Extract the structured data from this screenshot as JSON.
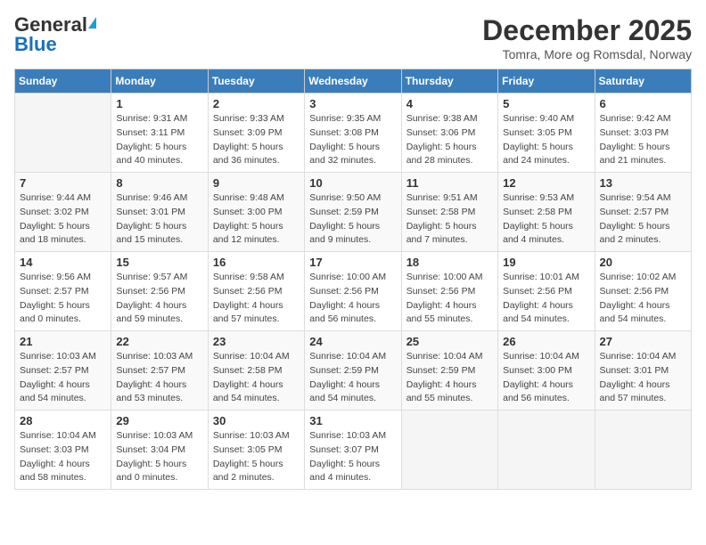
{
  "header": {
    "logo_general": "General",
    "logo_blue": "Blue",
    "month_year": "December 2025",
    "location": "Tomra, More og Romsdal, Norway"
  },
  "days_of_week": [
    "Sunday",
    "Monday",
    "Tuesday",
    "Wednesday",
    "Thursday",
    "Friday",
    "Saturday"
  ],
  "weeks": [
    [
      {
        "day": null,
        "info": null
      },
      {
        "day": "1",
        "info": "Sunrise: 9:31 AM\nSunset: 3:11 PM\nDaylight: 5 hours\nand 40 minutes."
      },
      {
        "day": "2",
        "info": "Sunrise: 9:33 AM\nSunset: 3:09 PM\nDaylight: 5 hours\nand 36 minutes."
      },
      {
        "day": "3",
        "info": "Sunrise: 9:35 AM\nSunset: 3:08 PM\nDaylight: 5 hours\nand 32 minutes."
      },
      {
        "day": "4",
        "info": "Sunrise: 9:38 AM\nSunset: 3:06 PM\nDaylight: 5 hours\nand 28 minutes."
      },
      {
        "day": "5",
        "info": "Sunrise: 9:40 AM\nSunset: 3:05 PM\nDaylight: 5 hours\nand 24 minutes."
      },
      {
        "day": "6",
        "info": "Sunrise: 9:42 AM\nSunset: 3:03 PM\nDaylight: 5 hours\nand 21 minutes."
      }
    ],
    [
      {
        "day": "7",
        "info": "Sunrise: 9:44 AM\nSunset: 3:02 PM\nDaylight: 5 hours\nand 18 minutes."
      },
      {
        "day": "8",
        "info": "Sunrise: 9:46 AM\nSunset: 3:01 PM\nDaylight: 5 hours\nand 15 minutes."
      },
      {
        "day": "9",
        "info": "Sunrise: 9:48 AM\nSunset: 3:00 PM\nDaylight: 5 hours\nand 12 minutes."
      },
      {
        "day": "10",
        "info": "Sunrise: 9:50 AM\nSunset: 2:59 PM\nDaylight: 5 hours\nand 9 minutes."
      },
      {
        "day": "11",
        "info": "Sunrise: 9:51 AM\nSunset: 2:58 PM\nDaylight: 5 hours\nand 7 minutes."
      },
      {
        "day": "12",
        "info": "Sunrise: 9:53 AM\nSunset: 2:58 PM\nDaylight: 5 hours\nand 4 minutes."
      },
      {
        "day": "13",
        "info": "Sunrise: 9:54 AM\nSunset: 2:57 PM\nDaylight: 5 hours\nand 2 minutes."
      }
    ],
    [
      {
        "day": "14",
        "info": "Sunrise: 9:56 AM\nSunset: 2:57 PM\nDaylight: 5 hours\nand 0 minutes."
      },
      {
        "day": "15",
        "info": "Sunrise: 9:57 AM\nSunset: 2:56 PM\nDaylight: 4 hours\nand 59 minutes."
      },
      {
        "day": "16",
        "info": "Sunrise: 9:58 AM\nSunset: 2:56 PM\nDaylight: 4 hours\nand 57 minutes."
      },
      {
        "day": "17",
        "info": "Sunrise: 10:00 AM\nSunset: 2:56 PM\nDaylight: 4 hours\nand 56 minutes."
      },
      {
        "day": "18",
        "info": "Sunrise: 10:00 AM\nSunset: 2:56 PM\nDaylight: 4 hours\nand 55 minutes."
      },
      {
        "day": "19",
        "info": "Sunrise: 10:01 AM\nSunset: 2:56 PM\nDaylight: 4 hours\nand 54 minutes."
      },
      {
        "day": "20",
        "info": "Sunrise: 10:02 AM\nSunset: 2:56 PM\nDaylight: 4 hours\nand 54 minutes."
      }
    ],
    [
      {
        "day": "21",
        "info": "Sunrise: 10:03 AM\nSunset: 2:57 PM\nDaylight: 4 hours\nand 54 minutes."
      },
      {
        "day": "22",
        "info": "Sunrise: 10:03 AM\nSunset: 2:57 PM\nDaylight: 4 hours\nand 53 minutes."
      },
      {
        "day": "23",
        "info": "Sunrise: 10:04 AM\nSunset: 2:58 PM\nDaylight: 4 hours\nand 54 minutes."
      },
      {
        "day": "24",
        "info": "Sunrise: 10:04 AM\nSunset: 2:59 PM\nDaylight: 4 hours\nand 54 minutes."
      },
      {
        "day": "25",
        "info": "Sunrise: 10:04 AM\nSunset: 2:59 PM\nDaylight: 4 hours\nand 55 minutes."
      },
      {
        "day": "26",
        "info": "Sunrise: 10:04 AM\nSunset: 3:00 PM\nDaylight: 4 hours\nand 56 minutes."
      },
      {
        "day": "27",
        "info": "Sunrise: 10:04 AM\nSunset: 3:01 PM\nDaylight: 4 hours\nand 57 minutes."
      }
    ],
    [
      {
        "day": "28",
        "info": "Sunrise: 10:04 AM\nSunset: 3:03 PM\nDaylight: 4 hours\nand 58 minutes."
      },
      {
        "day": "29",
        "info": "Sunrise: 10:03 AM\nSunset: 3:04 PM\nDaylight: 5 hours\nand 0 minutes."
      },
      {
        "day": "30",
        "info": "Sunrise: 10:03 AM\nSunset: 3:05 PM\nDaylight: 5 hours\nand 2 minutes."
      },
      {
        "day": "31",
        "info": "Sunrise: 10:03 AM\nSunset: 3:07 PM\nDaylight: 5 hours\nand 4 minutes."
      },
      {
        "day": null,
        "info": null
      },
      {
        "day": null,
        "info": null
      },
      {
        "day": null,
        "info": null
      }
    ]
  ]
}
